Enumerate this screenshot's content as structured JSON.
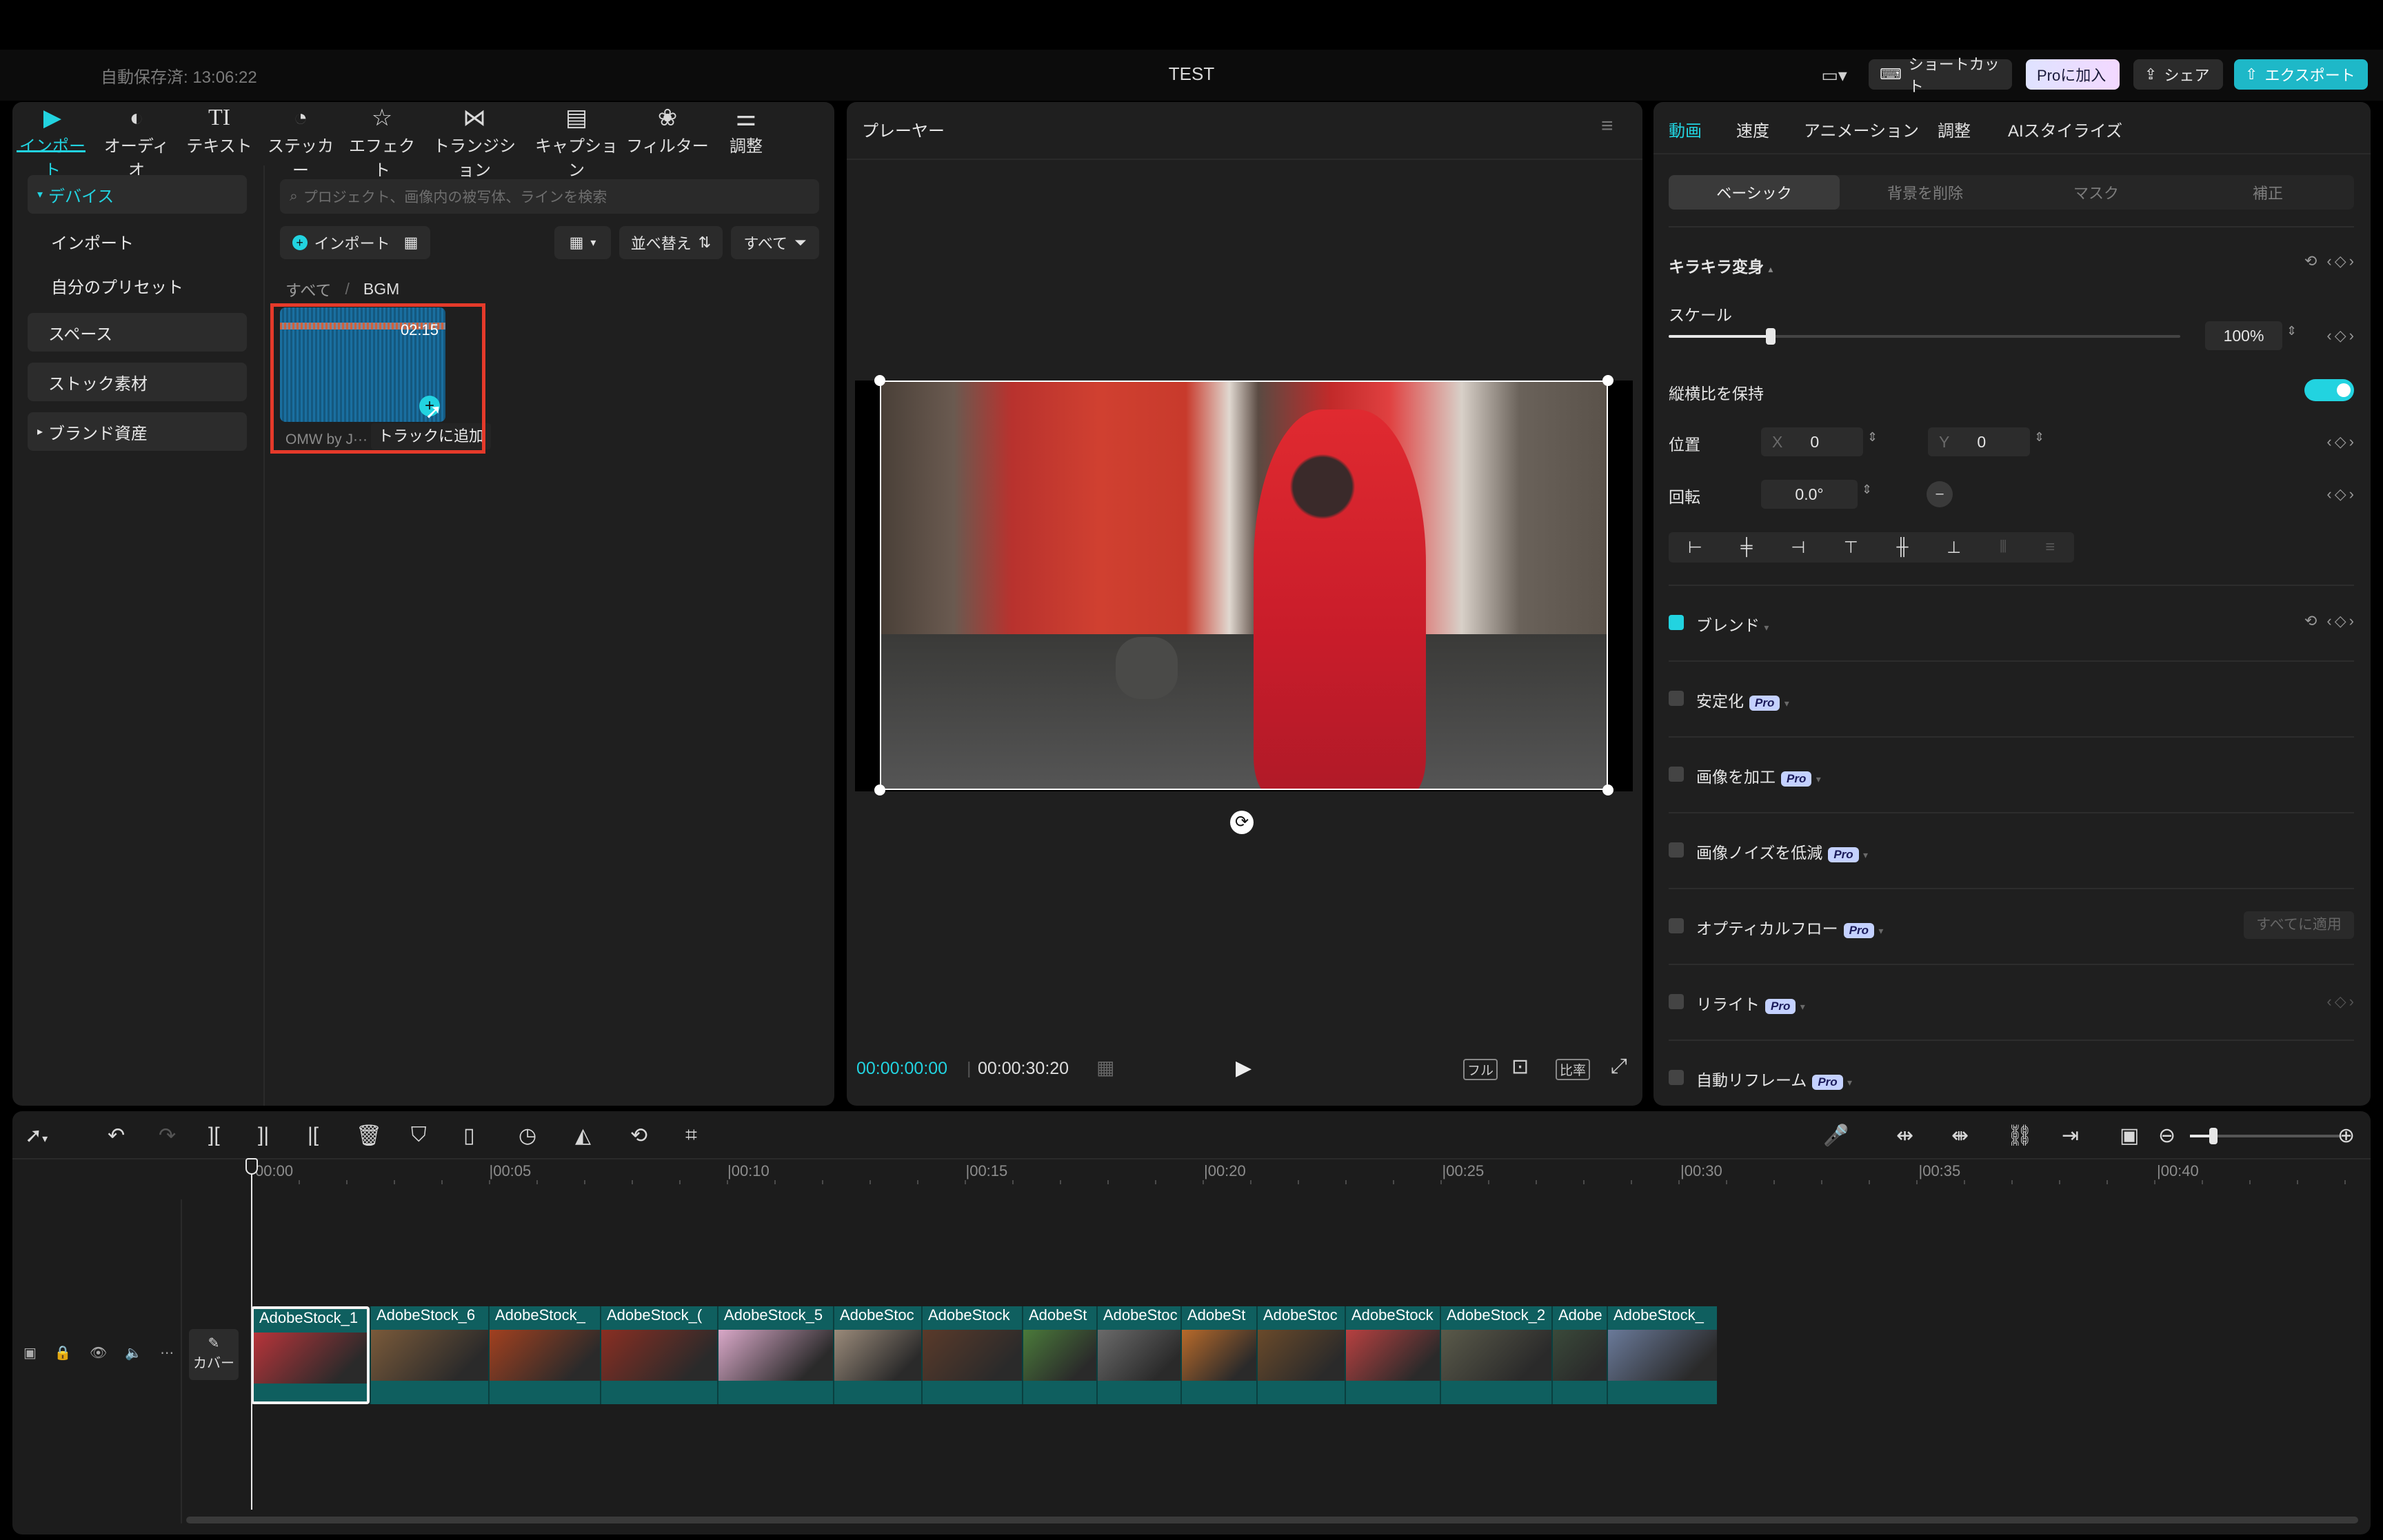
{
  "titlebar": {
    "autosave": "自動保存済: 13:06:22",
    "title": "TEST",
    "shortcut_label": "ショートカット",
    "pro_label": "Proに加入",
    "share_label": "シェア",
    "export_label": "エクスポート"
  },
  "media": {
    "tabs": [
      {
        "label": "インポート",
        "icon": "import-icon"
      },
      {
        "label": "オーディオ",
        "icon": "audio-icon"
      },
      {
        "label": "テキスト",
        "icon": "text-icon"
      },
      {
        "label": "ステッカー",
        "icon": "sticker-icon"
      },
      {
        "label": "エフェクト",
        "icon": "effect-icon"
      },
      {
        "label": "トランジション",
        "icon": "transition-icon"
      },
      {
        "label": "キャプション",
        "icon": "caption-icon"
      },
      {
        "label": "フィルター",
        "icon": "filter-icon"
      },
      {
        "label": "調整",
        "icon": "adjust-icon"
      }
    ],
    "text_icon_glyph": "TI",
    "sidebar": {
      "device": "デバイス",
      "import": "インポート",
      "presets": "自分のプリセット",
      "space": "スペース",
      "stock": "ストック素材",
      "brand": "ブランド資産"
    },
    "search_placeholder": "プロジェクト、画像内の被写体、ラインを検索",
    "import_button": "インポート",
    "sort_label": "並べ替え",
    "filter_label": "すべて",
    "breadcrumb_all": "すべて",
    "breadcrumb_sep": "/",
    "breadcrumb_current": "BGM",
    "item_duration": "02:15",
    "item_name": "OMW by J···",
    "tooltip": "トラックに追加"
  },
  "player": {
    "title": "プレーヤー",
    "current_time": "00:00:00:00",
    "total_time": "00:00:30:20",
    "full_label": "フル",
    "ratio_label": "比率"
  },
  "inspector": {
    "tabs": [
      "動画",
      "速度",
      "アニメーション",
      "調整",
      "AIスタイライズ"
    ],
    "segments": [
      "ベーシック",
      "背景を削除",
      "マスク",
      "補正"
    ],
    "transform_title": "キラキラ変身",
    "scale_label": "スケール",
    "scale_value": "100%",
    "scale_fraction": 0.2,
    "keep_ratio_label": "縦横比を保持",
    "position_label": "位置",
    "x_label": "X",
    "x_value": "0",
    "y_label": "Y",
    "y_value": "0",
    "rotation_label": "回転",
    "rotation_value": "0.0°",
    "blend_label": "ブレンド",
    "stabilize_label": "安定化",
    "enhance_label": "画像を加工",
    "denoise_label": "画像ノイズを低減",
    "optical_flow_label": "オプティカルフロー",
    "apply_all_label": "すべてに適用",
    "relight_label": "リライト",
    "auto_reframe_label": "自動リフレーム",
    "pro_badge": "Pro"
  },
  "timeline": {
    "ruler": [
      "00:00",
      "|00:05",
      "|00:10",
      "|00:15",
      "|00:20",
      "|00:25",
      "|00:30",
      "|00:35",
      "|00:40"
    ],
    "cover_label": "カバー",
    "clips": [
      {
        "name": "AdobeStock_1",
        "color": "#b8343a"
      },
      {
        "name": "AdobeStock_6",
        "color": "#7a5a3a"
      },
      {
        "name": "AdobeStock_",
        "color": "#a2401f"
      },
      {
        "name": "AdobeStock_(",
        "color": "#8a2e22"
      },
      {
        "name": "AdobeStock_5",
        "color": "#d9a8c8"
      },
      {
        "name": "AdobeStoc",
        "color": "#9a8a7a"
      },
      {
        "name": "AdobeStock",
        "color": "#5a3a2a"
      },
      {
        "name": "AdobeSt",
        "color": "#4a7a3a"
      },
      {
        "name": "AdobeStoc",
        "color": "#6a6a6a"
      },
      {
        "name": "AdobeSt",
        "color": "#b86a2a"
      },
      {
        "name": "AdobeStoc",
        "color": "#6a4a2a"
      },
      {
        "name": "AdobeStock",
        "color": "#b84040"
      },
      {
        "name": "AdobeStock_2",
        "color": "#5a5a4a"
      },
      {
        "name": "Adobe",
        "color": "#3a4a3a"
      },
      {
        "name": "AdobeStock_",
        "color": "#6a7a9a"
      }
    ]
  },
  "colors": {
    "accent": "#22d3e0",
    "selection": "#e53a2a",
    "clip_bg": "#0f5f5f"
  }
}
